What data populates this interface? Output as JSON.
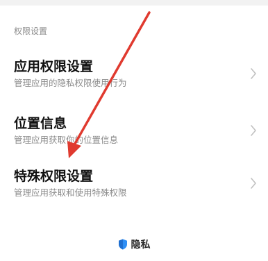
{
  "section": {
    "header": "权限设置"
  },
  "rows": [
    {
      "title": "应用权限设置",
      "subtitle": "管理应用的隐私权限使用行为"
    },
    {
      "title": "位置信息",
      "subtitle": "管理应用获取你的位置信息"
    },
    {
      "title": "特殊权限设置",
      "subtitle": "管理应用获取和使用特殊权限"
    }
  ],
  "footer": {
    "label": "隐私",
    "icon": "privacy-shield-icon",
    "icon_color": "#2f8ff5"
  },
  "annotation": {
    "arrow_color": "#e03a2f"
  }
}
